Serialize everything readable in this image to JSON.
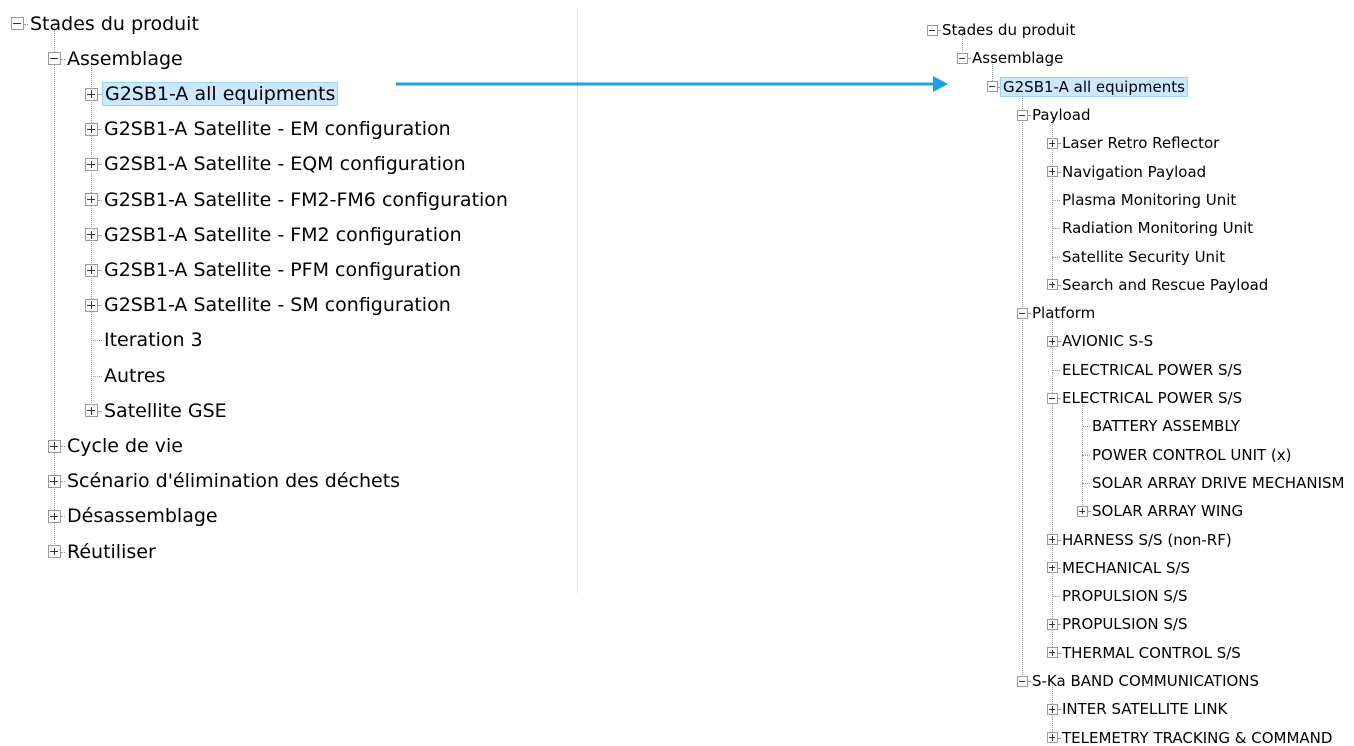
{
  "left_tree": {
    "nodes": [
      {
        "depth": 0,
        "label": "Stades du produit",
        "state": "expanded"
      },
      {
        "depth": 1,
        "label": "Assemblage",
        "state": "expanded"
      },
      {
        "depth": 2,
        "label": "G2SB1-A all equipments",
        "state": "collapsed",
        "selected": true
      },
      {
        "depth": 2,
        "label": "G2SB1-A Satellite - EM configuration",
        "state": "collapsed"
      },
      {
        "depth": 2,
        "label": "G2SB1-A Satellite - EQM configuration",
        "state": "collapsed"
      },
      {
        "depth": 2,
        "label": "G2SB1-A Satellite - FM2-FM6 configuration",
        "state": "collapsed"
      },
      {
        "depth": 2,
        "label": "G2SB1-A Satellite - FM2 configuration",
        "state": "collapsed"
      },
      {
        "depth": 2,
        "label": "G2SB1-A Satellite - PFM configuration",
        "state": "collapsed"
      },
      {
        "depth": 2,
        "label": "G2SB1-A Satellite - SM configuration",
        "state": "collapsed"
      },
      {
        "depth": 2,
        "label": "Iteration 3",
        "state": "leaf"
      },
      {
        "depth": 2,
        "label": "Autres",
        "state": "leaf"
      },
      {
        "depth": 2,
        "label": "Satellite GSE",
        "state": "collapsed"
      },
      {
        "depth": 1,
        "label": "Cycle de vie",
        "state": "collapsed"
      },
      {
        "depth": 1,
        "label": "Scénario d'élimination des déchets",
        "state": "collapsed"
      },
      {
        "depth": 1,
        "label": "Désassemblage",
        "state": "collapsed"
      },
      {
        "depth": 1,
        "label": "Réutiliser",
        "state": "collapsed"
      }
    ]
  },
  "right_tree": {
    "nodes": [
      {
        "depth": 0,
        "label": "Stades du produit",
        "state": "expanded"
      },
      {
        "depth": 1,
        "label": "Assemblage",
        "state": "expanded"
      },
      {
        "depth": 2,
        "label": "G2SB1-A all equipments",
        "state": "expanded",
        "selected": true
      },
      {
        "depth": 3,
        "label": "Payload",
        "state": "expanded"
      },
      {
        "depth": 4,
        "label": "Laser Retro Reflector",
        "state": "collapsed"
      },
      {
        "depth": 4,
        "label": "Navigation Payload",
        "state": "collapsed"
      },
      {
        "depth": 4,
        "label": "Plasma Monitoring Unit",
        "state": "leaf"
      },
      {
        "depth": 4,
        "label": "Radiation Monitoring Unit",
        "state": "leaf"
      },
      {
        "depth": 4,
        "label": "Satellite Security Unit",
        "state": "leaf"
      },
      {
        "depth": 4,
        "label": "Search and Rescue Payload",
        "state": "collapsed"
      },
      {
        "depth": 3,
        "label": "Platform",
        "state": "expanded"
      },
      {
        "depth": 4,
        "label": "AVIONIC S-S",
        "state": "collapsed"
      },
      {
        "depth": 4,
        "label": "ELECTRICAL POWER S/S",
        "state": "leaf"
      },
      {
        "depth": 4,
        "label": "ELECTRICAL POWER S/S",
        "state": "expanded"
      },
      {
        "depth": 5,
        "label": "BATTERY ASSEMBLY",
        "state": "leaf"
      },
      {
        "depth": 5,
        "label": "POWER CONTROL UNIT (x)",
        "state": "leaf"
      },
      {
        "depth": 5,
        "label": "SOLAR ARRAY DRIVE MECHANISM",
        "state": "leaf"
      },
      {
        "depth": 5,
        "label": "SOLAR ARRAY WING",
        "state": "collapsed"
      },
      {
        "depth": 4,
        "label": "HARNESS S/S (non-RF)",
        "state": "collapsed"
      },
      {
        "depth": 4,
        "label": "MECHANICAL S/S",
        "state": "collapsed"
      },
      {
        "depth": 4,
        "label": "PROPULSION S/S",
        "state": "leaf"
      },
      {
        "depth": 4,
        "label": "PROPULSION S/S",
        "state": "collapsed"
      },
      {
        "depth": 4,
        "label": "THERMAL CONTROL S/S",
        "state": "collapsed"
      },
      {
        "depth": 3,
        "label": "S-Ka BAND COMMUNICATIONS",
        "state": "expanded"
      },
      {
        "depth": 4,
        "label": "INTER SATELLITE LINK",
        "state": "collapsed"
      },
      {
        "depth": 4,
        "label": "TELEMETRY TRACKING & COMMAND",
        "state": "collapsed"
      }
    ]
  },
  "colors": {
    "selection_fill": "#cce8ff",
    "selection_border": "#99d1ff",
    "arrow": "#1ea0e8",
    "tree_lines": "#9a9a9a"
  }
}
